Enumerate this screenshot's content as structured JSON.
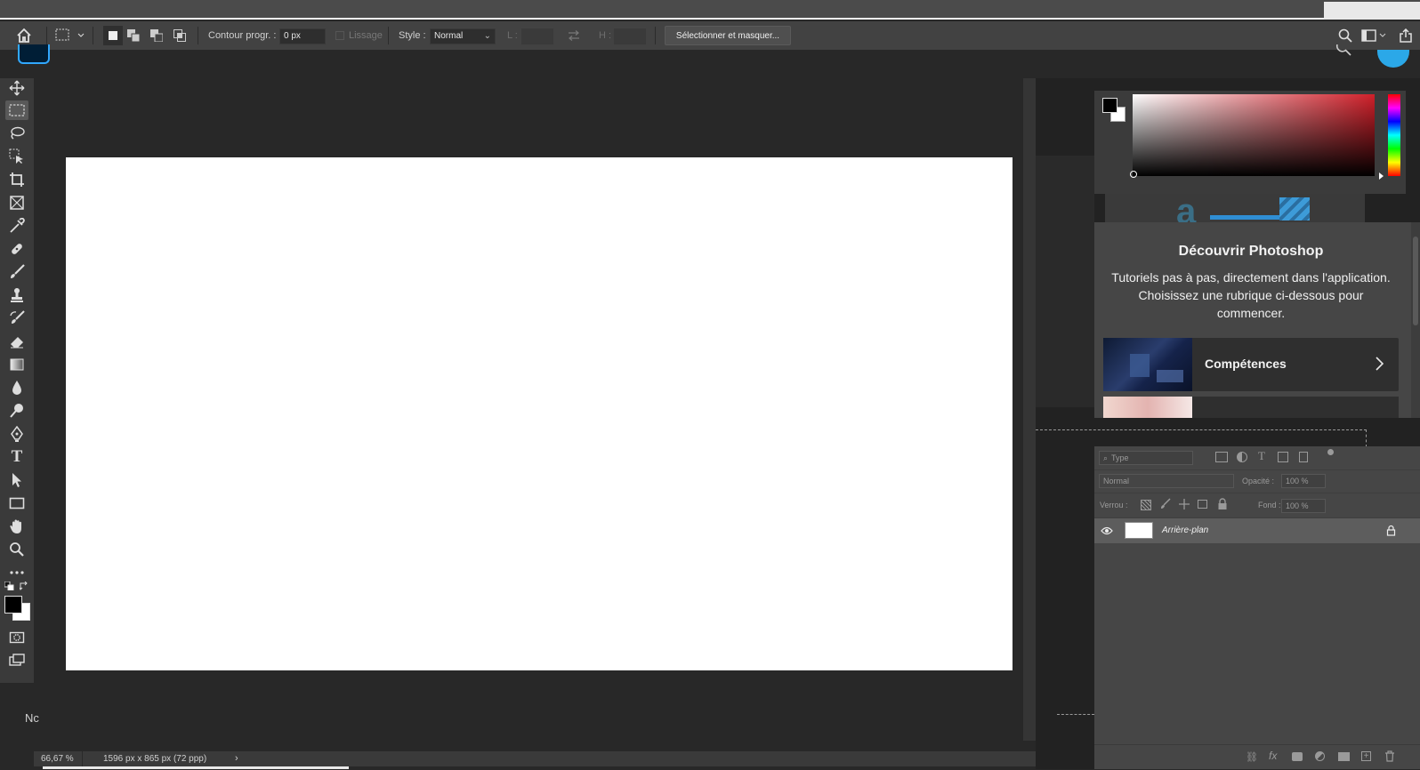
{
  "options_bar": {
    "feather_label": "Contour progr. :",
    "feather_value": "0 px",
    "antialias_label": "Lissage",
    "style_label": "Style :",
    "style_value": "Normal",
    "width_label": "L :",
    "height_label": "H :",
    "select_mask_button": "Sélectionner et masquer..."
  },
  "status_bar": {
    "zoom": "66,67 %",
    "doc_info": "1596 px x 865 px (72 ppp)"
  },
  "behind_label": "Nc",
  "discover": {
    "title": "Découvrir Photoshop",
    "description": "Tutoriels pas à pas, directement dans l'application. Choisissez une rubrique ci-dessous pour commencer.",
    "card_label": "Compétences"
  },
  "layers": {
    "filter_placeholder": "Type",
    "blend_mode": "Normal",
    "opacity_label": "Opacité :",
    "opacity_value": "100 %",
    "lock_label": "Verrou :",
    "fill_label": "Fond :",
    "fill_value": "100 %",
    "items": [
      {
        "name": "Arrière-plan",
        "visible": true,
        "locked": true
      }
    ]
  },
  "colors": {
    "foreground": "#000000",
    "background": "#ffffff",
    "picker_hue": "#d0202a",
    "accent": "#31a8ff"
  }
}
